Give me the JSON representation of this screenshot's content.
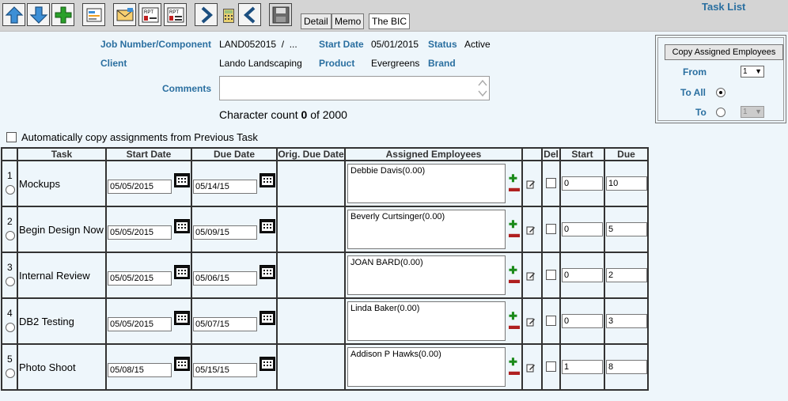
{
  "toolbar": {
    "icons": [
      "up-arrow-icon",
      "down-arrow-icon",
      "add-icon",
      "doc-icon",
      "email-icon",
      "report-icon",
      "report2-icon",
      "next-icon",
      "calculator-icon",
      "prev-icon",
      "save-icon"
    ],
    "detail_label": "Detail",
    "memo_label": "Memo",
    "bic_label": "The BIC",
    "task_list_label": "Task List"
  },
  "header": {
    "job_label": "Job Number/Component",
    "job_value": "LAND052015  /  ...",
    "start_date_label": "Start Date",
    "start_date_value": "05/01/2015",
    "status_label": "Status",
    "status_value": "Active",
    "client_label": "Client",
    "client_value": "Lando Landscaping",
    "product_label": "Product",
    "product_value": "Evergreens",
    "brand_label": "Brand",
    "comments_label": "Comments",
    "char_count_prefix": "Character count",
    "char_count": "0",
    "char_count_suffix": "of 2000",
    "auto_copy_label": "Automatically copy assignments from Previous Task"
  },
  "copy_panel": {
    "button_label": "Copy Assigned Employees",
    "from_label": "From",
    "from_value": "1",
    "to_all_label": "To All",
    "to_label": "To",
    "to_value": "1"
  },
  "table": {
    "headers": {
      "task": "Task",
      "start_date": "Start Date",
      "due_date": "Due Date",
      "orig_due_date": "Orig. Due Date",
      "assigned": "Assigned Employees",
      "del": "Del",
      "start": "Start",
      "due": "Due"
    },
    "rows": [
      {
        "num": "1",
        "task": "Mockups",
        "start_date": "05/05/2015",
        "due_date": "05/14/15",
        "employee": "Debbie Davis(0.00)",
        "start": "0",
        "due": "10"
      },
      {
        "num": "2",
        "task": "Begin Design Now",
        "start_date": "05/05/2015",
        "due_date": "05/09/15",
        "employee": "Beverly Curtsinger(0.00)",
        "start": "0",
        "due": "5"
      },
      {
        "num": "3",
        "task": "Internal Review",
        "start_date": "05/05/2015",
        "due_date": "05/06/15",
        "employee": "JOAN BARD(0.00)",
        "start": "0",
        "due": "2"
      },
      {
        "num": "4",
        "task": "DB2 Testing",
        "start_date": "05/05/2015",
        "due_date": "05/07/15",
        "employee": "Linda Baker(0.00)",
        "start": "0",
        "due": "3"
      },
      {
        "num": "5",
        "task": "Photo Shoot",
        "start_date": "05/08/15",
        "due_date": "05/15/15",
        "employee": "Addison P Hawks(0.00)",
        "start": "1",
        "due": "8"
      }
    ]
  }
}
